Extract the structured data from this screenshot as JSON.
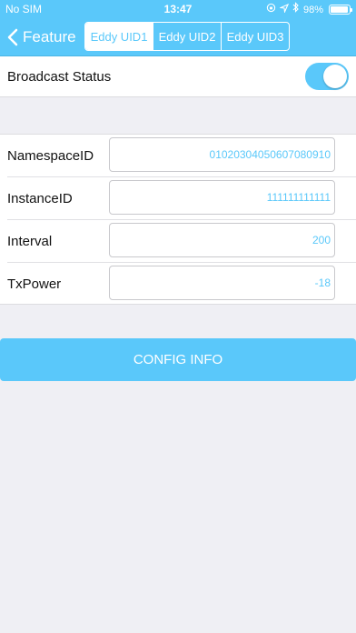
{
  "statusbar": {
    "carrier": "No SIM",
    "time": "13:47",
    "battery_text": "98%",
    "battery_level": 0.98,
    "icons": [
      "lock-rotation-icon",
      "location-arrow-icon",
      "bluetooth-icon",
      "battery-icon"
    ]
  },
  "nav": {
    "back_label": "Feature",
    "back_icon": "chevron-left-icon",
    "segments": [
      {
        "label": "Eddy UID1",
        "selected": true
      },
      {
        "label": "Eddy UID2",
        "selected": false
      },
      {
        "label": "Eddy UID3",
        "selected": false
      }
    ]
  },
  "broadcast": {
    "label": "Broadcast Status",
    "enabled": true
  },
  "form": {
    "fields": [
      {
        "label": "NamespaceID",
        "value": "01020304050607080910"
      },
      {
        "label": "InstanceID",
        "value": "111111111111"
      },
      {
        "label": "Interval",
        "value": "200"
      },
      {
        "label": "TxPower",
        "value": "-18"
      }
    ]
  },
  "config_button": {
    "label": "CONFIG INFO"
  },
  "colors": {
    "accent": "#5ac8fa",
    "background": "#efeff4"
  }
}
